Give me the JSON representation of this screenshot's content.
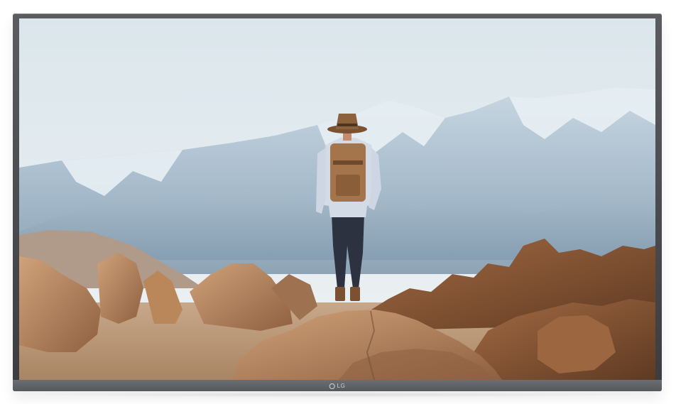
{
  "device": {
    "type": "television",
    "brand_logo_text": "LG"
  },
  "screen_content": {
    "scene": "hiker-on-rock-mountain-view"
  },
  "colors": {
    "sky": "#e2ebf0",
    "mountain": "#aabccc",
    "rock": "#b9875a",
    "bezel": "#4a4c50"
  }
}
